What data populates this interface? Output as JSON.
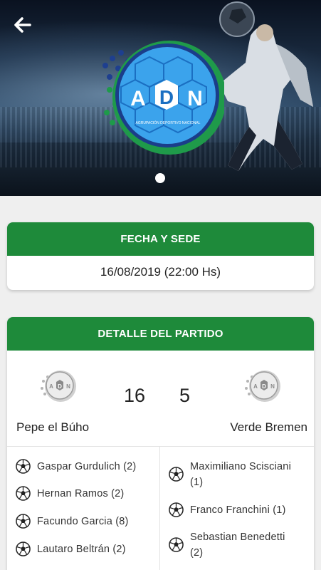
{
  "header": {
    "back_icon": "arrow-left-icon",
    "brand_logo": {
      "letters": [
        "A",
        "D",
        "N"
      ],
      "subtitle": "AGRUPACIÓN DEPORTIVO NACIONAL"
    },
    "carousel_active_index": 0,
    "carousel_count": 1
  },
  "fecha": {
    "title": "FECHA Y SEDE",
    "datetime": "16/08/2019 (22:00 Hs)"
  },
  "partido": {
    "title": "DETALLE DEL PARTIDO",
    "home": {
      "name": "Pepe el Búho",
      "score": "16",
      "logo_letters": [
        "A",
        "D",
        "N"
      ]
    },
    "away": {
      "name": "Verde Bremen",
      "score": "5",
      "logo_letters": [
        "A",
        "D",
        "N"
      ]
    },
    "home_scorers": [
      {
        "text": "Gaspar Gurdulich (2)"
      },
      {
        "text": "Hernan Ramos (2)"
      },
      {
        "text": "Facundo Garcia (8)"
      },
      {
        "text": "Lautaro Beltrán (2)"
      }
    ],
    "away_scorers": [
      {
        "line1": "Maximiliano Scisciani",
        "line2": "(1)"
      },
      {
        "line1": "Franco Franchini (1)",
        "line2": ""
      },
      {
        "line1": "Sebastian Benedetti",
        "line2": "(2)"
      }
    ]
  },
  "colors": {
    "accent_green": "#1e8a3a",
    "logo_blue": "#2f9ee8",
    "background": "#efefef"
  }
}
